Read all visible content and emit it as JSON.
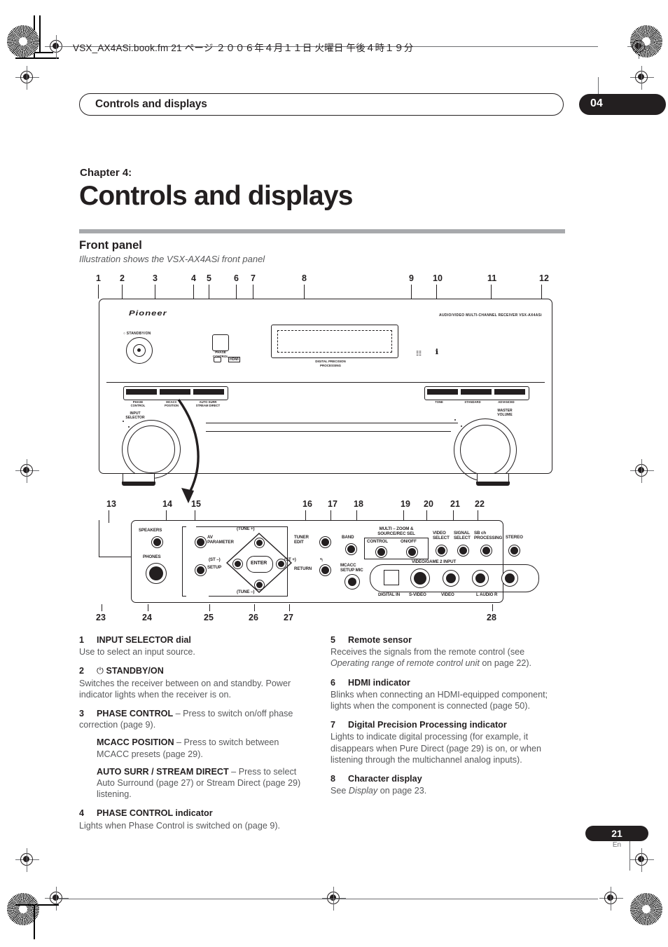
{
  "document": {
    "file_line": "VSX_AX4ASi.book.fm  21 ページ  ２００６年４月１１日   火曜日   午後４時１９分",
    "running_head": "Controls and displays",
    "chapter_number": "04",
    "chapter_label": "Chapter 4:",
    "chapter_title": "Controls and displays",
    "section_title": "Front panel",
    "section_subtitle": "Illustration shows the VSX-AX4ASi front panel",
    "page_number": "21",
    "page_language": "En"
  },
  "figure": {
    "callouts_top": [
      "1",
      "2",
      "3",
      "4",
      "5",
      "6",
      "7",
      "8",
      "9",
      "10",
      "11",
      "12"
    ],
    "callouts_mid": [
      "13",
      "14",
      "15",
      "16",
      "17",
      "18",
      "19",
      "20",
      "21",
      "22"
    ],
    "callouts_bottom": [
      "23",
      "24",
      "25",
      "26",
      "27",
      "28"
    ],
    "brand": "Pioneer",
    "model_line": "AUDIO/VIDEO MULTI-CHANNEL RECEIVER   VSX-AX4ASi",
    "standby_label": "STANDBY/ON",
    "phase_control_label": "PHASE\nCONTROL",
    "hdmi_label": "HDMI",
    "dpp_label": "DIGITAL PRECISION\nPROCESSING",
    "input_selector_label": "INPUT\nSELECTOR",
    "master_volume_label": "MASTER\nVOLUME",
    "upper_buttons_left": [
      "PHASE CONTROL",
      "MCACC POSITION",
      "AUTO SURR/ STREAM DIRECT"
    ],
    "upper_buttons_right": [
      "TONE",
      "STANDARD",
      "ADVANCED"
    ],
    "door_controls": {
      "speakers": "SPEAKERS",
      "phones": "PHONES",
      "av_parameter": "AV PARAMETER",
      "setup": "SETUP",
      "enter": "ENTER",
      "tune_up": "(TUNE +)",
      "tune_down": "(TUNE –)",
      "st_left": "(ST –)",
      "st_right": "(ST +)",
      "tuner_edit": "TUNER EDIT",
      "return": "RETURN",
      "band": "BAND",
      "multizoom": "MULTI – ZOOM &\nSOURCE/REC SEL",
      "control": "CONTROL",
      "on_off": "ON/OFF",
      "video_select": "VIDEO SELECT",
      "signal_select": "SIGNAL SELECT",
      "sb_processing": "SB ch PROCESSING",
      "stereo": "STEREO",
      "mcacc_setup_mic": "MCACC SETUP MIC",
      "video_game2": "VIDEO/GAME 2 INPUT",
      "jacks": [
        "DIGITAL IN",
        "S-VIDEO",
        "VIDEO",
        "L  AUDIO  R"
      ]
    }
  },
  "descriptions_left": [
    {
      "num": "1",
      "heading": "INPUT SELECTOR dial",
      "body": "Use to select an input source."
    },
    {
      "num": "2",
      "heading": "STANDBY/ON",
      "power_glyph": "⏻",
      "body": "Switches the receiver between on and standby. Power indicator lights when the receiver is on."
    },
    {
      "num": "3",
      "heading": "PHASE CONTROL",
      "heading_rest": " – Press to switch on/off phase correction (page 9).",
      "sub": [
        {
          "bold": "MCACC POSITION",
          "rest": " – Press to switch between MCACC presets (page 29)."
        },
        {
          "bold": "AUTO SURR / STREAM DIRECT",
          "rest": " – Press to select Auto Surround (page 27) or Stream Direct (page 29) listening."
        }
      ]
    },
    {
      "num": "4",
      "heading": "PHASE CONTROL indicator",
      "body": "Lights when Phase Control is switched on (page 9)."
    }
  ],
  "descriptions_right": [
    {
      "num": "5",
      "heading": "Remote sensor",
      "body_pre": "Receives the signals from the remote control (see ",
      "body_italic": "Operating range of remote control unit",
      "body_post": " on page 22)."
    },
    {
      "num": "6",
      "heading": "HDMI indicator",
      "body": "Blinks when connecting an HDMI-equipped component; lights when the component is connected (page 50)."
    },
    {
      "num": "7",
      "heading": "Digital Precision Processing indicator",
      "body": "Lights to indicate digital processing (for example, it disappears when Pure Direct (page 29) is on, or when listening through the multichannel analog inputs)."
    },
    {
      "num": "8",
      "heading": "Character display",
      "body_pre": "See ",
      "body_italic": "Display",
      "body_post": " on page 23."
    }
  ]
}
